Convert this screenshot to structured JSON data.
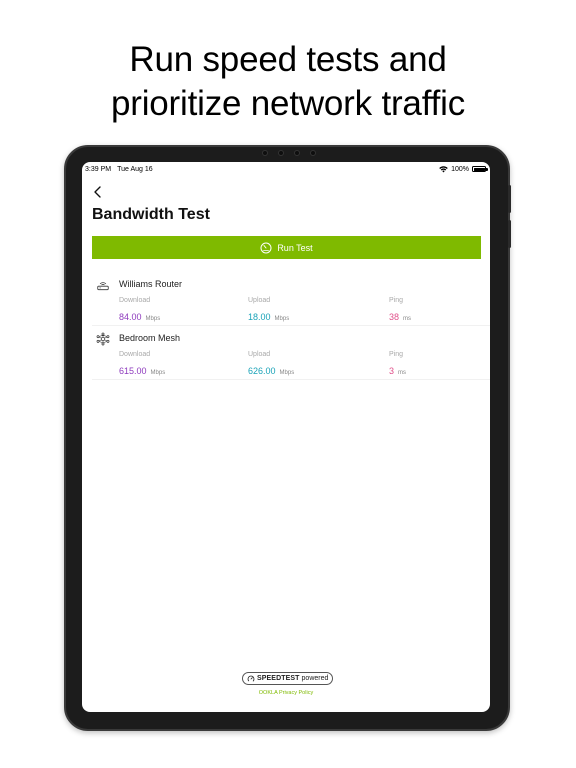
{
  "headline": {
    "line1": "Run speed tests and",
    "line2": "prioritize network traffic"
  },
  "status_bar": {
    "time": "3:39 PM",
    "date": "Tue Aug 16",
    "battery": "100%"
  },
  "page": {
    "title": "Bandwidth Test",
    "run_button_label": "Run Test"
  },
  "metric_labels": {
    "download": "Download",
    "upload": "Upload",
    "ping": "Ping"
  },
  "devices": [
    {
      "name": "Williams Router",
      "icon": "router-icon",
      "download": "84.00",
      "download_unit": "Mbps",
      "upload": "18.00",
      "upload_unit": "Mbps",
      "ping": "38",
      "ping_unit": "ms"
    },
    {
      "name": "Bedroom Mesh",
      "icon": "mesh-node-icon",
      "download": "615.00",
      "download_unit": "Mbps",
      "upload": "626.00",
      "upload_unit": "Mbps",
      "ping": "3",
      "ping_unit": "ms"
    }
  ],
  "footer": {
    "badge_brand": "SPEEDTEST",
    "badge_suffix": "powered",
    "privacy_link": "OOKLA Privacy Policy"
  },
  "colors": {
    "accent_green": "#7fba00",
    "download": "#8e3bbd",
    "upload": "#1aa3b8",
    "ping": "#e0508a"
  }
}
